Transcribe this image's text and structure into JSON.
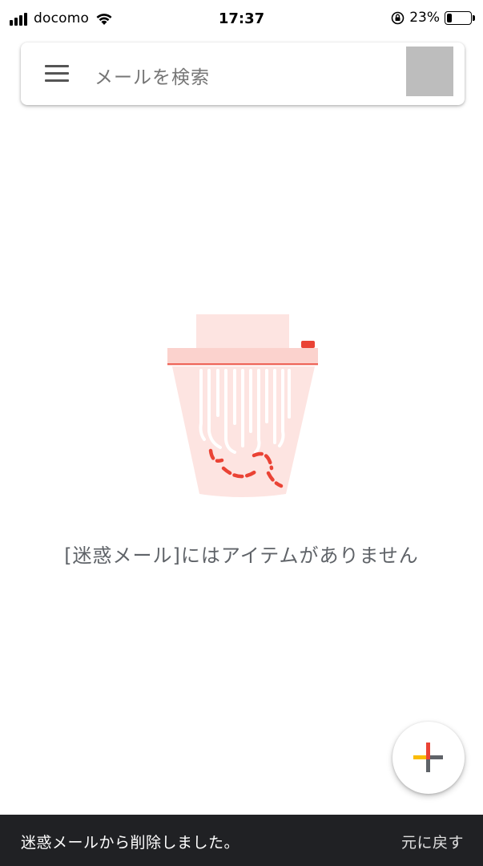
{
  "status_bar": {
    "carrier": "docomo",
    "time": "17:37",
    "battery_percent": "23%",
    "battery_level": 0.23,
    "icons": [
      "signal-icon",
      "wifi-icon",
      "orientation-lock-icon",
      "battery-icon"
    ]
  },
  "search": {
    "placeholder": "メールを検索",
    "menu_icon": "menu-icon"
  },
  "empty_state": {
    "illustration": "shredder-illustration",
    "message": "[迷惑メール]にはアイテムがありません"
  },
  "compose_button": {
    "icon": "plus-icon",
    "colors": [
      "#ea4335",
      "#fbbc04",
      "#34a853",
      "#4285f4",
      "#5f6368"
    ]
  },
  "snackbar": {
    "message": "迷惑メールから削除しました。",
    "action": "元に戻す"
  },
  "colors": {
    "accent_red": "#ea4335",
    "shredder_light": "#fde4e1",
    "snackbar_bg": "#202124"
  }
}
